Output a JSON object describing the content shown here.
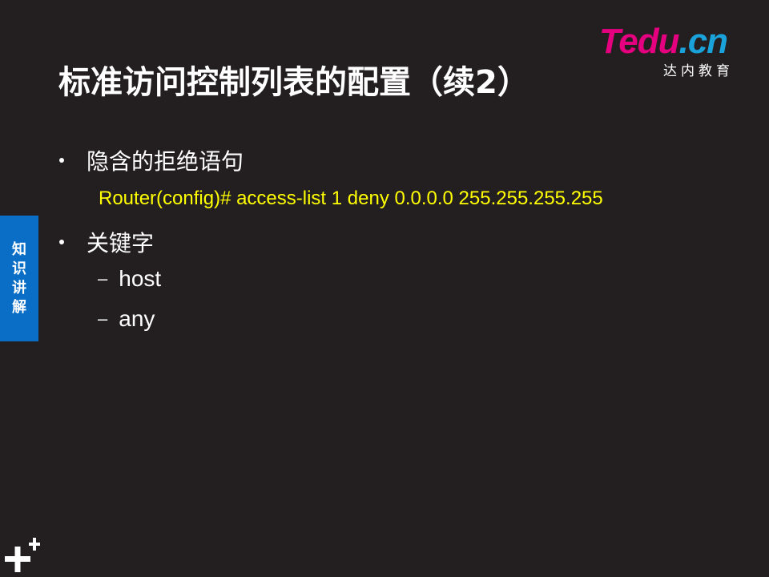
{
  "title": "标准访问控制列表的配置（续2）",
  "logo": {
    "brand": "Tedu.cn",
    "brand_parts": [
      "T",
      "edu",
      ".cn"
    ],
    "subtitle": "达内教育",
    "colors": {
      "pink": "#e5007f",
      "blue": "#1aa2db"
    }
  },
  "side_tab": {
    "chars": [
      "知",
      "识",
      "讲",
      "解"
    ],
    "color": "#0a6ec7"
  },
  "content": {
    "bullet1": "隐含的拒绝语句",
    "code": "Router(config)# access-list 1 deny 0.0.0.0 255.255.255.255",
    "bullet2": "关键字",
    "sub_items": [
      "host",
      "any"
    ],
    "dash": "–"
  },
  "colors": {
    "background": "#231f20",
    "text": "#ffffff",
    "code": "#ffff00"
  },
  "icons": {
    "corner": "plus-plus-icon"
  }
}
